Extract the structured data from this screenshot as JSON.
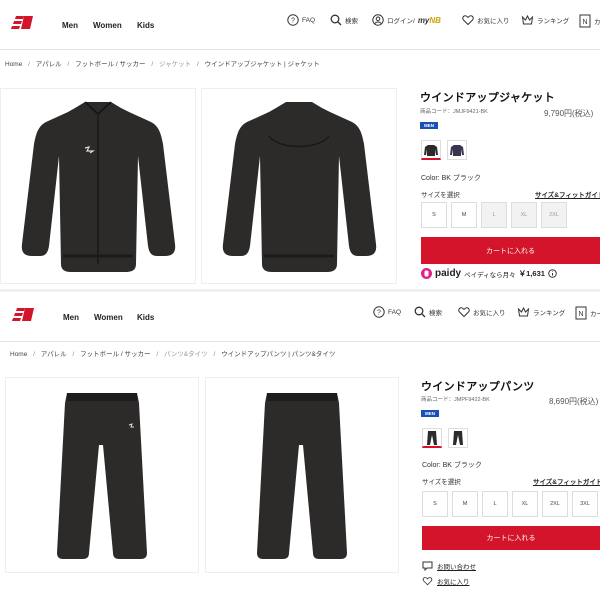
{
  "nav": {
    "links": [
      "Men",
      "Women",
      "Kids"
    ],
    "faq": "FAQ",
    "search": "検索",
    "login": "ログイン/",
    "mynb_my": "my",
    "mynb_nb": "NB",
    "favorites": "お気に入り",
    "ranking": "ランキング",
    "cart": "カート"
  },
  "jacket": {
    "breadcrumb": [
      "Home",
      "/",
      "アパレル",
      "/",
      "フットボール / サッカー",
      "/",
      "ジャケット",
      "/",
      "ウインドアップジャケット | ジャケット"
    ],
    "title": "ウインドアップジャケット",
    "code": "商品コード：JMJF9421-BK",
    "price": "9,790円(税込)",
    "badge": "MEN",
    "color": "Color: BK ブラック",
    "size_label": "サイズを選択",
    "size_guide": "サイズ&フィットガイド",
    "sizes": [
      "S",
      "M",
      "L",
      "XL",
      "2XL"
    ],
    "cart_button": "カートに入れる",
    "paidy_logo": "paidy",
    "paidy_text": "ペイディなら月々",
    "paidy_amount": "￥1,631"
  },
  "pants": {
    "breadcrumb": [
      "Home",
      "/",
      "アパレル",
      "/",
      "フットボール / サッカー",
      "/",
      "パンツ&タイツ",
      "/",
      "ウインドアップパンツ | パンツ&タイツ"
    ],
    "title": "ウインドアップパンツ",
    "code": "商品コード：JMPF9422-BK",
    "price": "8,690円(税込)",
    "badge": "MEN",
    "color": "Color: BK ブラック",
    "size_label": "サイズを選択",
    "size_guide": "サイズ&フィットガイド",
    "sizes": [
      "S",
      "M",
      "L",
      "XL",
      "2XL",
      "3XL"
    ],
    "cart_button": "カートに入れる",
    "inquiry": "お問い合わせ",
    "favorite": "お気に入り"
  },
  "colors": {
    "accent": "#d3142a",
    "badge": "#1b4fb8",
    "garment": "#2d2a2a"
  }
}
